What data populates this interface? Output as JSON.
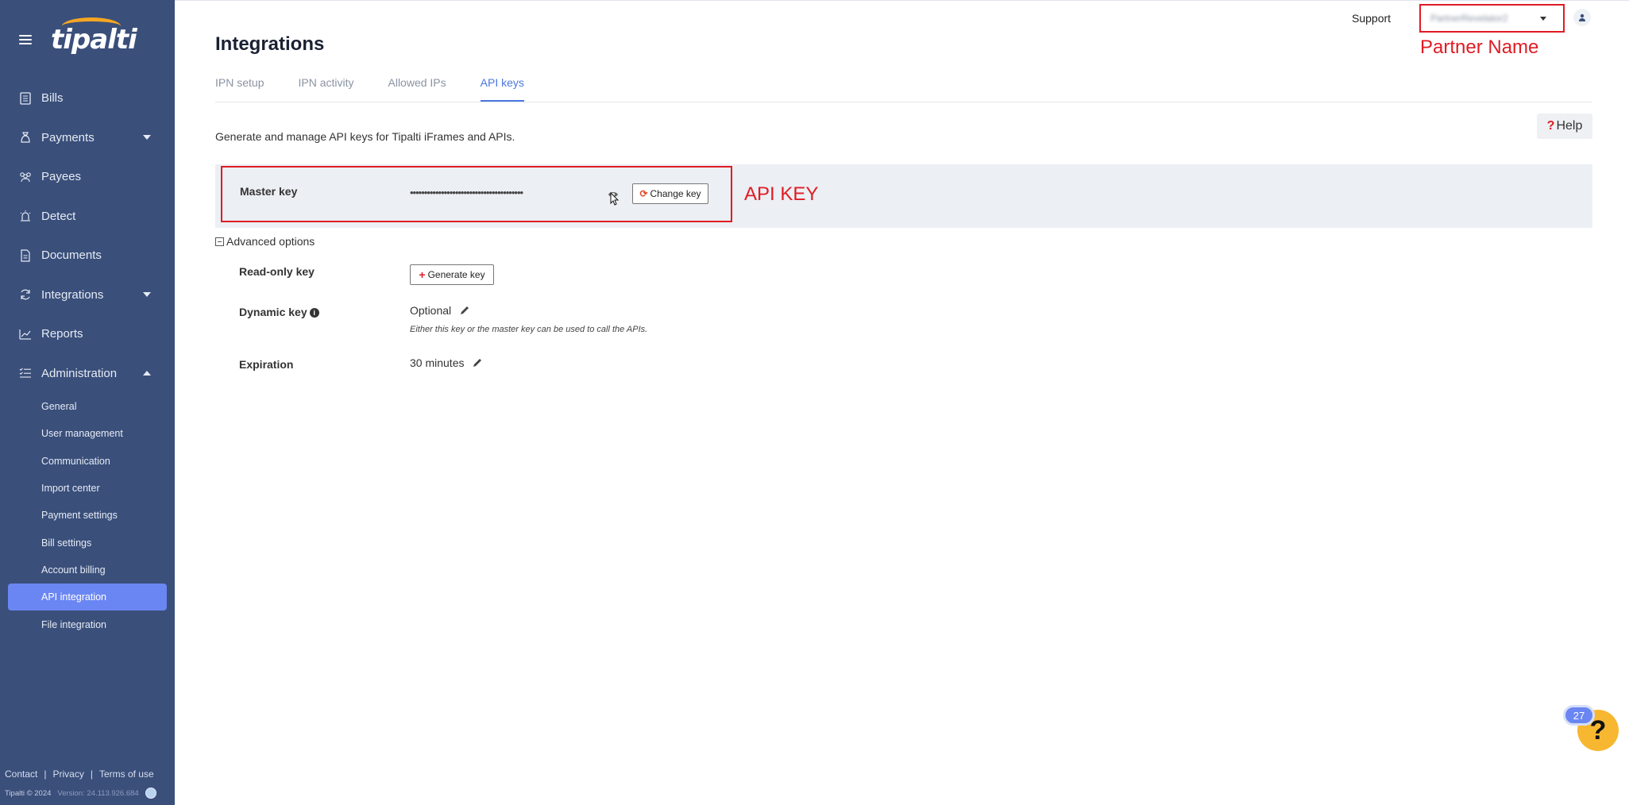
{
  "brand": {
    "logo_text": "tipalti",
    "accent": "#f5a623"
  },
  "sidebar": {
    "bg_color": "#3a4f7a",
    "items": [
      {
        "label": "Bills",
        "icon": "bill-icon"
      },
      {
        "label": "Payments",
        "icon": "payments-icon",
        "caret": "down"
      },
      {
        "label": "Payees",
        "icon": "payees-icon"
      },
      {
        "label": "Detect",
        "icon": "detect-icon"
      },
      {
        "label": "Documents",
        "icon": "document-icon"
      },
      {
        "label": "Integrations",
        "icon": "integrations-icon",
        "caret": "down"
      },
      {
        "label": "Reports",
        "icon": "reports-icon"
      },
      {
        "label": "Administration",
        "icon": "administration-icon",
        "caret": "up"
      }
    ],
    "subitems": [
      {
        "label": "General"
      },
      {
        "label": "User management"
      },
      {
        "label": "Communication"
      },
      {
        "label": "Import center"
      },
      {
        "label": "Payment settings"
      },
      {
        "label": "Bill settings"
      },
      {
        "label": "Account billing"
      },
      {
        "label": "API integration",
        "active": true
      },
      {
        "label": "File integration"
      }
    ],
    "footer": {
      "links": [
        "Contact",
        "Privacy",
        "Terms of use"
      ],
      "copyright": "Tipalti © 2024",
      "version": "Version: 24.113.926.684"
    }
  },
  "topbar": {
    "support_label": "Support",
    "partner_name": "PartnerRevelator2",
    "partner_annotation": "Partner Name"
  },
  "page": {
    "title": "Integrations",
    "tabs": [
      {
        "label": "IPN setup"
      },
      {
        "label": "IPN activity"
      },
      {
        "label": "Allowed IPs"
      },
      {
        "label": "API keys",
        "active": true
      }
    ],
    "help_label": "Help",
    "description": "Generate and manage API keys for Tipalti iFrames and APIs.",
    "master": {
      "label": "Master key",
      "masked_value": "••••••••••••••••••••••••••••••••••••••••",
      "change_label": "Change key",
      "annotation": "API KEY"
    },
    "advanced_label": "Advanced options",
    "readonly": {
      "label": "Read-only key",
      "button_label": "Generate key"
    },
    "dynamic": {
      "label": "Dynamic key",
      "value": "Optional",
      "hint": "Either this key or the master key can be used to call the APIs."
    },
    "expiration": {
      "label": "Expiration",
      "value": "30 minutes"
    }
  },
  "chat": {
    "badge_count": "27",
    "icon": "question-icon"
  },
  "colors": {
    "annotation_red": "#e01b24",
    "tab_active": "#4a78e0",
    "active_nav": "#6a86f2"
  }
}
